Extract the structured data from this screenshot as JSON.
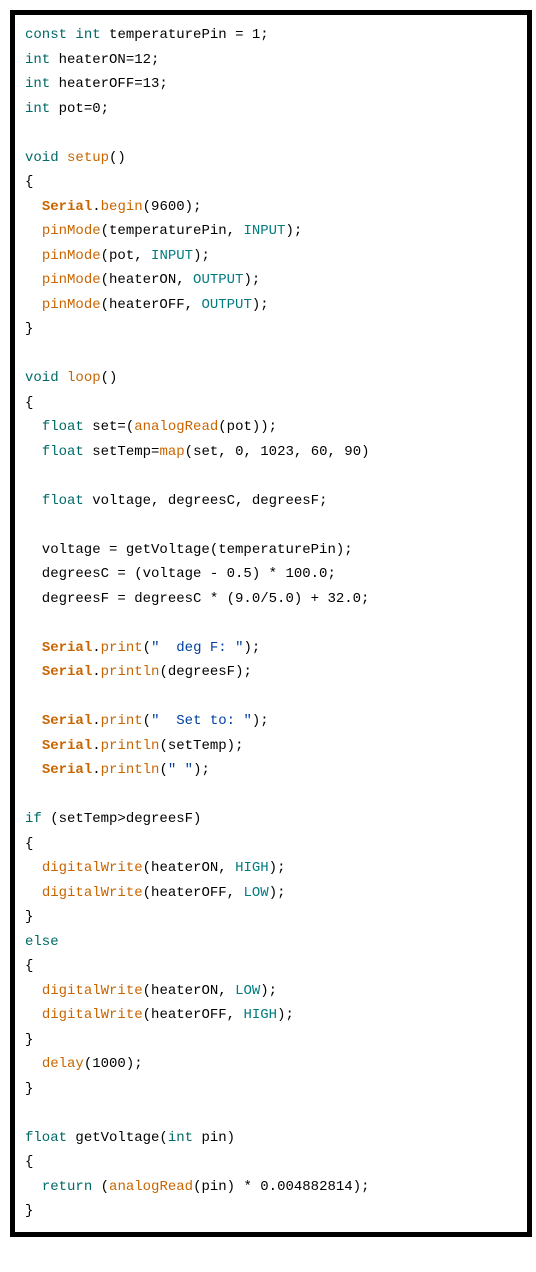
{
  "code": {
    "lines": [
      [
        {
          "t": "const ",
          "c": "tok-kw"
        },
        {
          "t": "int",
          "c": "tok-kw"
        },
        {
          "t": " temperaturePin = 1;",
          "c": "tok-plain"
        }
      ],
      [
        {
          "t": "int",
          "c": "tok-kw"
        },
        {
          "t": " heaterON=12;",
          "c": "tok-plain"
        }
      ],
      [
        {
          "t": "int",
          "c": "tok-kw"
        },
        {
          "t": " heaterOFF=13;",
          "c": "tok-plain"
        }
      ],
      [
        {
          "t": "int",
          "c": "tok-kw"
        },
        {
          "t": " pot=0;",
          "c": "tok-plain"
        }
      ],
      [],
      [
        {
          "t": "void",
          "c": "tok-kw"
        },
        {
          "t": " ",
          "c": "tok-plain"
        },
        {
          "t": "setup",
          "c": "tok-type"
        },
        {
          "t": "()",
          "c": "tok-plain"
        }
      ],
      [
        {
          "t": "{",
          "c": "tok-plain"
        }
      ],
      [
        {
          "t": "  ",
          "c": "tok-plain"
        },
        {
          "t": "Serial",
          "c": "tok-obj"
        },
        {
          "t": ".",
          "c": "tok-plain"
        },
        {
          "t": "begin",
          "c": "tok-type"
        },
        {
          "t": "(9600);",
          "c": "tok-plain"
        }
      ],
      [
        {
          "t": "  ",
          "c": "tok-plain"
        },
        {
          "t": "pinMode",
          "c": "tok-type"
        },
        {
          "t": "(temperaturePin, ",
          "c": "tok-plain"
        },
        {
          "t": "INPUT",
          "c": "tok-const"
        },
        {
          "t": ");",
          "c": "tok-plain"
        }
      ],
      [
        {
          "t": "  ",
          "c": "tok-plain"
        },
        {
          "t": "pinMode",
          "c": "tok-type"
        },
        {
          "t": "(pot, ",
          "c": "tok-plain"
        },
        {
          "t": "INPUT",
          "c": "tok-const"
        },
        {
          "t": ");",
          "c": "tok-plain"
        }
      ],
      [
        {
          "t": "  ",
          "c": "tok-plain"
        },
        {
          "t": "pinMode",
          "c": "tok-type"
        },
        {
          "t": "(heaterON, ",
          "c": "tok-plain"
        },
        {
          "t": "OUTPUT",
          "c": "tok-const"
        },
        {
          "t": ");",
          "c": "tok-plain"
        }
      ],
      [
        {
          "t": "  ",
          "c": "tok-plain"
        },
        {
          "t": "pinMode",
          "c": "tok-type"
        },
        {
          "t": "(heaterOFF, ",
          "c": "tok-plain"
        },
        {
          "t": "OUTPUT",
          "c": "tok-const"
        },
        {
          "t": ");",
          "c": "tok-plain"
        }
      ],
      [
        {
          "t": "}",
          "c": "tok-plain"
        }
      ],
      [],
      [
        {
          "t": "void",
          "c": "tok-kw"
        },
        {
          "t": " ",
          "c": "tok-plain"
        },
        {
          "t": "loop",
          "c": "tok-type"
        },
        {
          "t": "()",
          "c": "tok-plain"
        }
      ],
      [
        {
          "t": "{",
          "c": "tok-plain"
        }
      ],
      [
        {
          "t": "  ",
          "c": "tok-plain"
        },
        {
          "t": "float",
          "c": "tok-kw"
        },
        {
          "t": " set=(",
          "c": "tok-plain"
        },
        {
          "t": "analogRead",
          "c": "tok-type"
        },
        {
          "t": "(pot));",
          "c": "tok-plain"
        }
      ],
      [
        {
          "t": "  ",
          "c": "tok-plain"
        },
        {
          "t": "float",
          "c": "tok-kw"
        },
        {
          "t": " setTemp=",
          "c": "tok-plain"
        },
        {
          "t": "map",
          "c": "tok-type"
        },
        {
          "t": "(set, 0, 1023, 60, 90)",
          "c": "tok-plain"
        }
      ],
      [],
      [
        {
          "t": "  ",
          "c": "tok-plain"
        },
        {
          "t": "float",
          "c": "tok-kw"
        },
        {
          "t": " voltage, degreesC, degreesF;",
          "c": "tok-plain"
        }
      ],
      [],
      [
        {
          "t": "  voltage = getVoltage(temperaturePin);",
          "c": "tok-plain"
        }
      ],
      [
        {
          "t": "  degreesC = (voltage - 0.5) * 100.0;",
          "c": "tok-plain"
        }
      ],
      [
        {
          "t": "  degreesF = degreesC * (9.0/5.0) + 32.0;",
          "c": "tok-plain"
        }
      ],
      [],
      [
        {
          "t": "  ",
          "c": "tok-plain"
        },
        {
          "t": "Serial",
          "c": "tok-obj"
        },
        {
          "t": ".",
          "c": "tok-plain"
        },
        {
          "t": "print",
          "c": "tok-type"
        },
        {
          "t": "(",
          "c": "tok-plain"
        },
        {
          "t": "\"  deg F: \"",
          "c": "tok-str"
        },
        {
          "t": ");",
          "c": "tok-plain"
        }
      ],
      [
        {
          "t": "  ",
          "c": "tok-plain"
        },
        {
          "t": "Serial",
          "c": "tok-obj"
        },
        {
          "t": ".",
          "c": "tok-plain"
        },
        {
          "t": "println",
          "c": "tok-type"
        },
        {
          "t": "(degreesF);",
          "c": "tok-plain"
        }
      ],
      [],
      [
        {
          "t": "  ",
          "c": "tok-plain"
        },
        {
          "t": "Serial",
          "c": "tok-obj"
        },
        {
          "t": ".",
          "c": "tok-plain"
        },
        {
          "t": "print",
          "c": "tok-type"
        },
        {
          "t": "(",
          "c": "tok-plain"
        },
        {
          "t": "\"  Set to: \"",
          "c": "tok-str"
        },
        {
          "t": ");",
          "c": "tok-plain"
        }
      ],
      [
        {
          "t": "  ",
          "c": "tok-plain"
        },
        {
          "t": "Serial",
          "c": "tok-obj"
        },
        {
          "t": ".",
          "c": "tok-plain"
        },
        {
          "t": "println",
          "c": "tok-type"
        },
        {
          "t": "(setTemp);",
          "c": "tok-plain"
        }
      ],
      [
        {
          "t": "  ",
          "c": "tok-plain"
        },
        {
          "t": "Serial",
          "c": "tok-obj"
        },
        {
          "t": ".",
          "c": "tok-plain"
        },
        {
          "t": "println",
          "c": "tok-type"
        },
        {
          "t": "(",
          "c": "tok-plain"
        },
        {
          "t": "\" \"",
          "c": "tok-str"
        },
        {
          "t": ");",
          "c": "tok-plain"
        }
      ],
      [],
      [
        {
          "t": "if",
          "c": "tok-kw"
        },
        {
          "t": " (setTemp>degreesF)",
          "c": "tok-plain"
        }
      ],
      [
        {
          "t": "{",
          "c": "tok-plain"
        }
      ],
      [
        {
          "t": "  ",
          "c": "tok-plain"
        },
        {
          "t": "digitalWrite",
          "c": "tok-type"
        },
        {
          "t": "(heaterON, ",
          "c": "tok-plain"
        },
        {
          "t": "HIGH",
          "c": "tok-const"
        },
        {
          "t": ");",
          "c": "tok-plain"
        }
      ],
      [
        {
          "t": "  ",
          "c": "tok-plain"
        },
        {
          "t": "digitalWrite",
          "c": "tok-type"
        },
        {
          "t": "(heaterOFF, ",
          "c": "tok-plain"
        },
        {
          "t": "LOW",
          "c": "tok-const"
        },
        {
          "t": ");",
          "c": "tok-plain"
        }
      ],
      [
        {
          "t": "}",
          "c": "tok-plain"
        }
      ],
      [
        {
          "t": "else",
          "c": "tok-kw"
        }
      ],
      [
        {
          "t": "{",
          "c": "tok-plain"
        }
      ],
      [
        {
          "t": "  ",
          "c": "tok-plain"
        },
        {
          "t": "digitalWrite",
          "c": "tok-type"
        },
        {
          "t": "(heaterON, ",
          "c": "tok-plain"
        },
        {
          "t": "LOW",
          "c": "tok-const"
        },
        {
          "t": ");",
          "c": "tok-plain"
        }
      ],
      [
        {
          "t": "  ",
          "c": "tok-plain"
        },
        {
          "t": "digitalWrite",
          "c": "tok-type"
        },
        {
          "t": "(heaterOFF, ",
          "c": "tok-plain"
        },
        {
          "t": "HIGH",
          "c": "tok-const"
        },
        {
          "t": ");",
          "c": "tok-plain"
        }
      ],
      [
        {
          "t": "}",
          "c": "tok-plain"
        }
      ],
      [
        {
          "t": "  ",
          "c": "tok-plain"
        },
        {
          "t": "delay",
          "c": "tok-type"
        },
        {
          "t": "(1000);",
          "c": "tok-plain"
        }
      ],
      [
        {
          "t": "}",
          "c": "tok-plain"
        }
      ],
      [],
      [
        {
          "t": "float",
          "c": "tok-kw"
        },
        {
          "t": " getVoltage(",
          "c": "tok-plain"
        },
        {
          "t": "int",
          "c": "tok-kw"
        },
        {
          "t": " pin)",
          "c": "tok-plain"
        }
      ],
      [
        {
          "t": "{",
          "c": "tok-plain"
        }
      ],
      [
        {
          "t": "  ",
          "c": "tok-plain"
        },
        {
          "t": "return",
          "c": "tok-kw"
        },
        {
          "t": " (",
          "c": "tok-plain"
        },
        {
          "t": "analogRead",
          "c": "tok-type"
        },
        {
          "t": "(pin) * 0.004882814);",
          "c": "tok-plain"
        }
      ],
      [
        {
          "t": "}",
          "c": "tok-plain"
        }
      ]
    ]
  }
}
